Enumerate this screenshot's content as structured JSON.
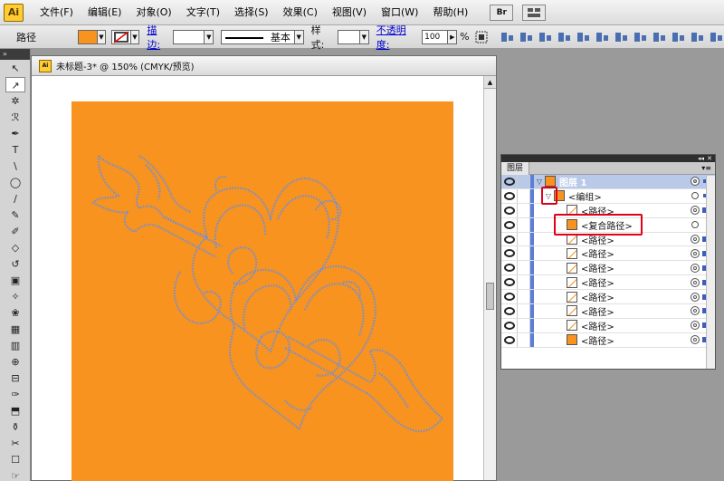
{
  "app": {
    "logo": "Ai",
    "menus": [
      "文件(F)",
      "编辑(E)",
      "对象(O)",
      "文字(T)",
      "选择(S)",
      "效果(C)",
      "视图(V)",
      "窗口(W)",
      "帮助(H)"
    ],
    "bridge_button": "Br"
  },
  "control_bar": {
    "selection_label": "路径",
    "fill_color": "#f7931e",
    "stroke_label": "描边:",
    "stroke_style": "基本",
    "style_label": "样式:",
    "opacity_label": "不透明度:",
    "opacity_value": "100",
    "opacity_unit": "%"
  },
  "tools": [
    "↖",
    "↗",
    "✲",
    "ℛ",
    "✒",
    "T",
    "\\",
    "◯",
    "∕",
    "✎",
    "✐",
    "◇",
    "↺",
    "▣",
    "✧",
    "❀",
    "▦",
    "▥",
    "⊕",
    "⊟",
    "✑",
    "⬒",
    "⚱",
    "✂",
    "☐",
    "☞"
  ],
  "document": {
    "title": "未标题-3* @ 150% (CMYK/预览)",
    "artboard_color": "#f7931e",
    "path_color": "#6e8fe0"
  },
  "layers_panel": {
    "tab": "图层",
    "rows": [
      {
        "name": "图层 1",
        "expander": "▽",
        "thumb": "orange",
        "target": "dbl",
        "select": "small"
      },
      {
        "name": "<编组>",
        "expander": "▽",
        "thumb": "orange",
        "target": "single",
        "select": "small"
      },
      {
        "name": "<路径>",
        "expander": "",
        "thumb": "line",
        "target": "dbl",
        "select": "box"
      },
      {
        "name": "<复合路径>",
        "expander": "",
        "thumb": "orange",
        "target": "single",
        "select": "none"
      },
      {
        "name": "<路径>",
        "expander": "",
        "thumb": "line",
        "target": "dbl",
        "select": "box"
      },
      {
        "name": "<路径>",
        "expander": "",
        "thumb": "line",
        "target": "dbl",
        "select": "box"
      },
      {
        "name": "<路径>",
        "expander": "",
        "thumb": "line",
        "target": "dbl",
        "select": "box"
      },
      {
        "name": "<路径>",
        "expander": "",
        "thumb": "line",
        "target": "dbl",
        "select": "box"
      },
      {
        "name": "<路径>",
        "expander": "",
        "thumb": "line",
        "target": "dbl",
        "select": "box"
      },
      {
        "name": "<路径>",
        "expander": "",
        "thumb": "line",
        "target": "dbl",
        "select": "box"
      },
      {
        "name": "<路径>",
        "expander": "",
        "thumb": "line",
        "target": "dbl",
        "select": "box"
      },
      {
        "name": "<路径>",
        "expander": "",
        "thumb": "orange",
        "target": "dbl",
        "select": "box"
      }
    ]
  },
  "annotation_color": "#e0001a"
}
